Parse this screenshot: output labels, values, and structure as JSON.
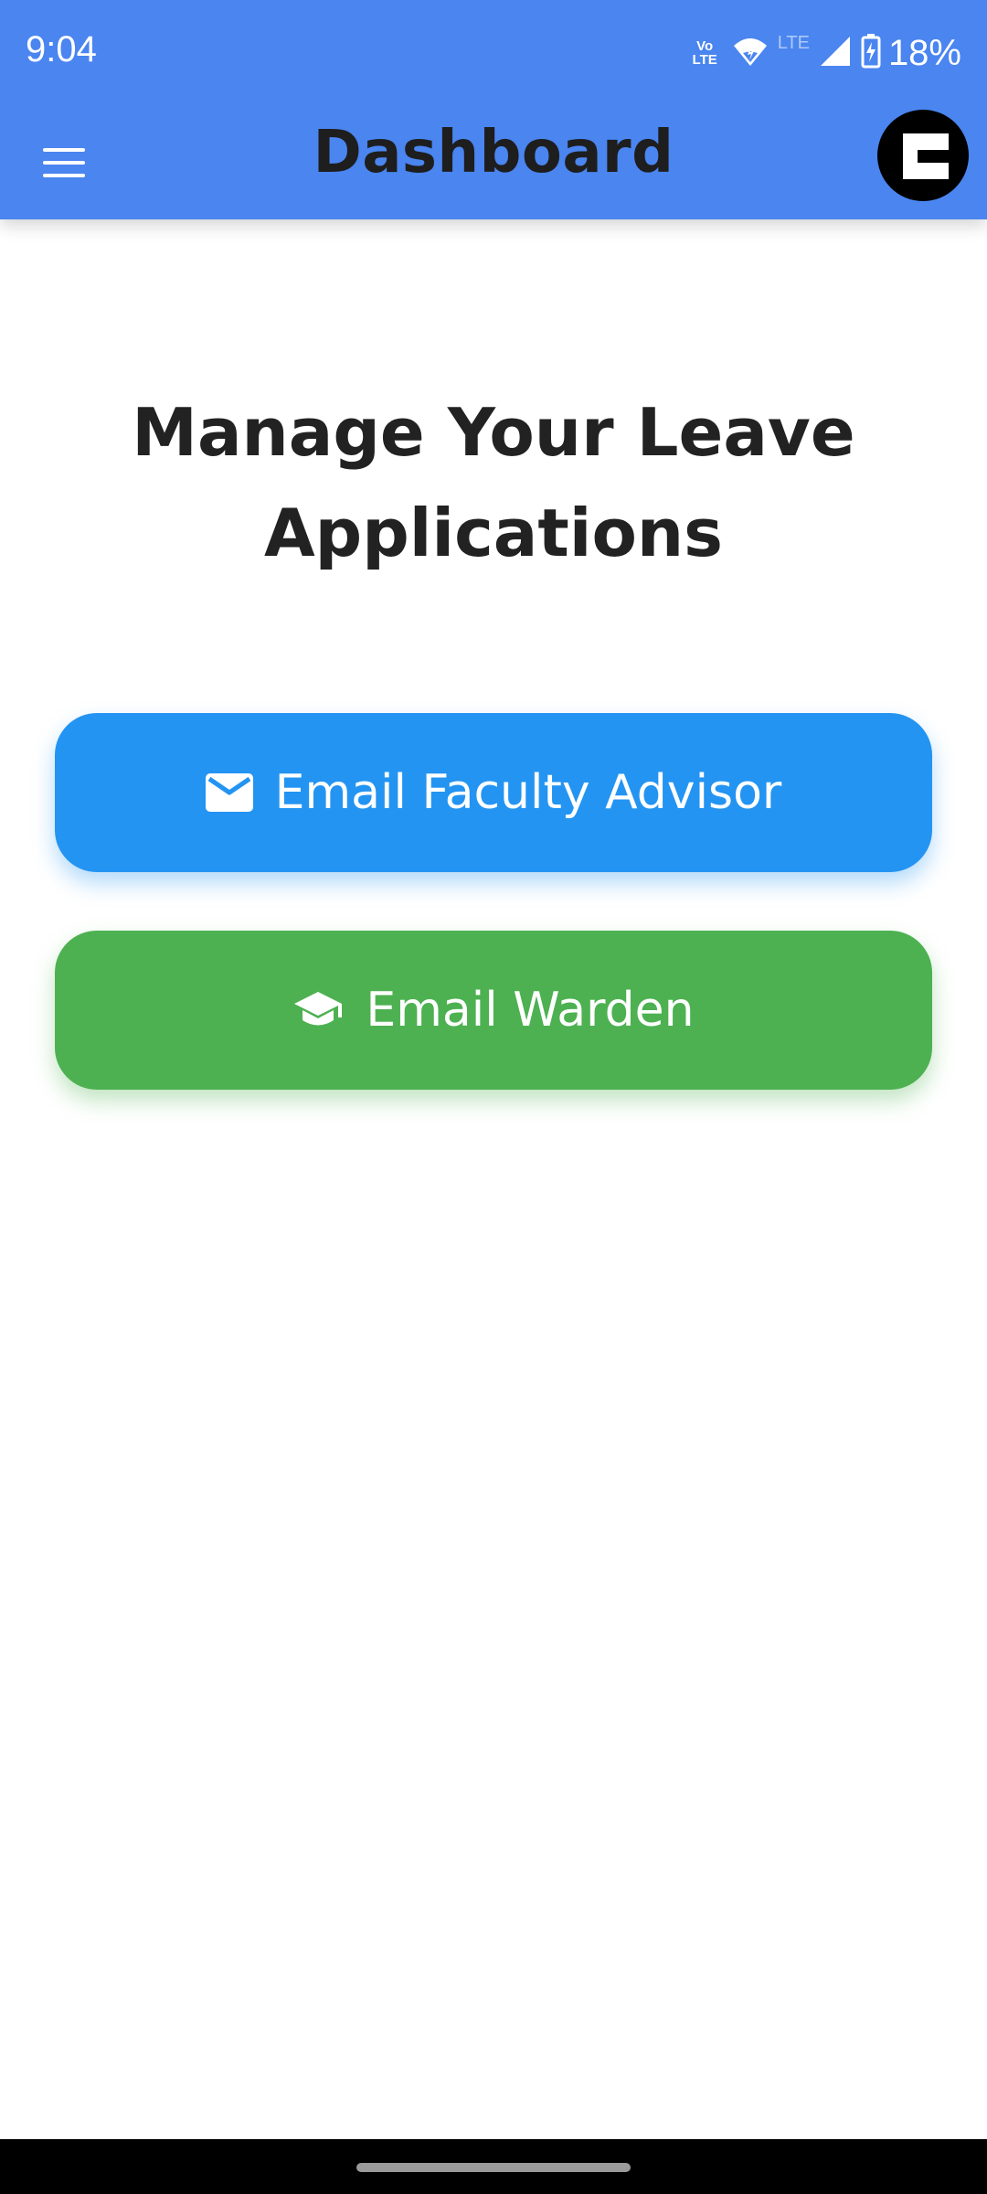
{
  "status_bar": {
    "time": "9:04",
    "volte_top": "Vo",
    "volte_bottom": "LTE",
    "lte": "LTE",
    "battery": "18%",
    "icons": [
      "volte-icon",
      "wifi-icon",
      "signal-icon",
      "battery-charging-icon"
    ]
  },
  "app_bar": {
    "title": "Dashboard",
    "menu_icon": "hamburger-menu-icon",
    "avatar_icon": "profile-avatar"
  },
  "main": {
    "heading": "Manage Your Leave Applications",
    "buttons": [
      {
        "label": "Email Faculty Advisor",
        "icon": "email-icon",
        "color": "#2394f2"
      },
      {
        "label": "Email Warden",
        "icon": "graduation-cap-icon",
        "color": "#4db151"
      }
    ]
  },
  "colors": {
    "app_bar": "#4a85f0",
    "title_text": "#1e1e1e",
    "heading_text": "#222222"
  }
}
